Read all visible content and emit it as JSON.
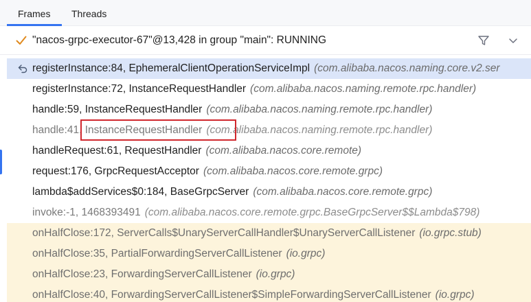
{
  "tabs": [
    {
      "label": "Frames",
      "active": true
    },
    {
      "label": "Threads",
      "active": false
    }
  ],
  "thread": {
    "status_icon": "check-icon",
    "label": "\"nacos-grpc-executor-67\"@13,428 in group \"main\": RUNNING",
    "filter_icon": "filter-icon",
    "dropdown_icon": "chevron-down-icon"
  },
  "frames": [
    {
      "method": "registerInstance:84, EphemeralClientOperationServiceImpl",
      "package": "(com.alibaba.nacos.naming.core.v2.ser",
      "style": "selected"
    },
    {
      "method": "registerInstance:72, InstanceRequestHandler",
      "package": "(com.alibaba.nacos.naming.remote.rpc.handler)",
      "style": "normal"
    },
    {
      "method": "handle:59, InstanceRequestHandler",
      "package": "(com.alibaba.nacos.naming.remote.rpc.handler)",
      "style": "normal"
    },
    {
      "method": "handle:41, InstanceRequestHandler",
      "package": "(com.alibaba.nacos.naming.remote.rpc.handler)",
      "style": "dim"
    },
    {
      "method": "handleRequest:61, RequestHandler",
      "package": "(com.alibaba.nacos.core.remote)",
      "style": "normal"
    },
    {
      "method": "request:176, GrpcRequestAcceptor",
      "package": "(com.alibaba.nacos.core.remote.grpc)",
      "style": "normal"
    },
    {
      "method": "lambda$addServices$0:184, BaseGrpcServer",
      "package": "(com.alibaba.nacos.core.remote.grpc)",
      "style": "normal"
    },
    {
      "method": "invoke:-1, 1468393491",
      "package": "(com.alibaba.nacos.core.remote.grpc.BaseGrpcServer$$Lambda$798)",
      "style": "dim"
    },
    {
      "method": "onHalfClose:172, ServerCalls$UnaryServerCallHandler$UnaryServerCallListener",
      "package": "(io.grpc.stub)",
      "style": "lib"
    },
    {
      "method": "onHalfClose:35, PartialForwardingServerCallListener",
      "package": "(io.grpc)",
      "style": "lib"
    },
    {
      "method": "onHalfClose:23, ForwardingServerCallListener",
      "package": "(io.grpc)",
      "style": "lib"
    },
    {
      "method": "onHalfClose:40, ForwardingServerCallListener$SimpleForwardingServerCallListener",
      "package": "(io.grpc)",
      "style": "lib"
    }
  ],
  "colors": {
    "accent": "#3574f0",
    "selected_row": "#dbe5f9",
    "library_row": "#fdf4dc",
    "check": "#e08a1e",
    "highlight": "#d0282e"
  }
}
